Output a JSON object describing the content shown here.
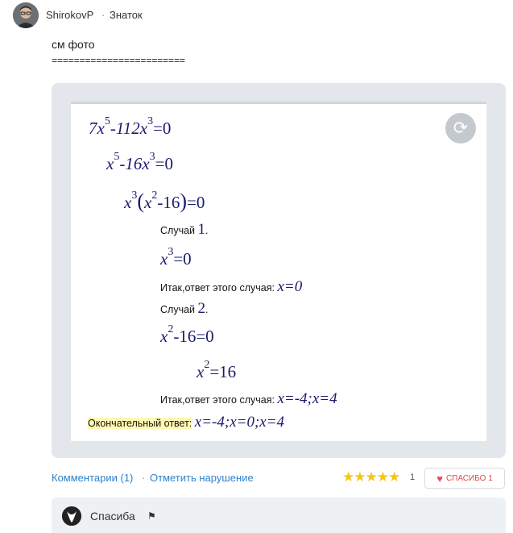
{
  "header": {
    "username": "ShirokovP",
    "separator": "·",
    "rank": "Знаток"
  },
  "answer": {
    "text": "см фото",
    "line": "========================"
  },
  "solution": {
    "eq1": [
      "7x",
      "5",
      "-112x",
      "3",
      "=0"
    ],
    "eq2": [
      "x",
      "5",
      "-16x",
      "3",
      "=0"
    ],
    "eq3": [
      "x",
      "3",
      "(",
      "x",
      "2",
      "-16",
      ")",
      "=0"
    ],
    "case1_label": "Случай",
    "case1_num": "1",
    "case1_dot": ".",
    "case1_eq": [
      "x",
      "3",
      "=0"
    ],
    "case1_answer_label": "Итак,ответ этого случая:",
    "case1_answer": "x=0",
    "case2_label": "Случай",
    "case2_num": "2",
    "case2_dot": ".",
    "case2_eq1": [
      "x",
      "2",
      "-16=0"
    ],
    "case2_eq2": [
      "x",
      "2",
      "=16"
    ],
    "case2_answer_label": "Итак,ответ этого случая:",
    "case2_answer": "x=-4;x=4",
    "final_label": "Окончательный ответ:",
    "final_answer": "x=-4;x=0;x=4"
  },
  "footer": {
    "comments": "Комментарии (1)",
    "separator": "·",
    "report": "Отметить нарушение",
    "stars": "★★★★★",
    "rating_count": "1",
    "thanks_label": "СПАСИБО 1"
  },
  "comment": {
    "text": "Спасиба",
    "flag": "⚑"
  },
  "icons": {
    "rotate": "⟳",
    "heart": "♥"
  }
}
